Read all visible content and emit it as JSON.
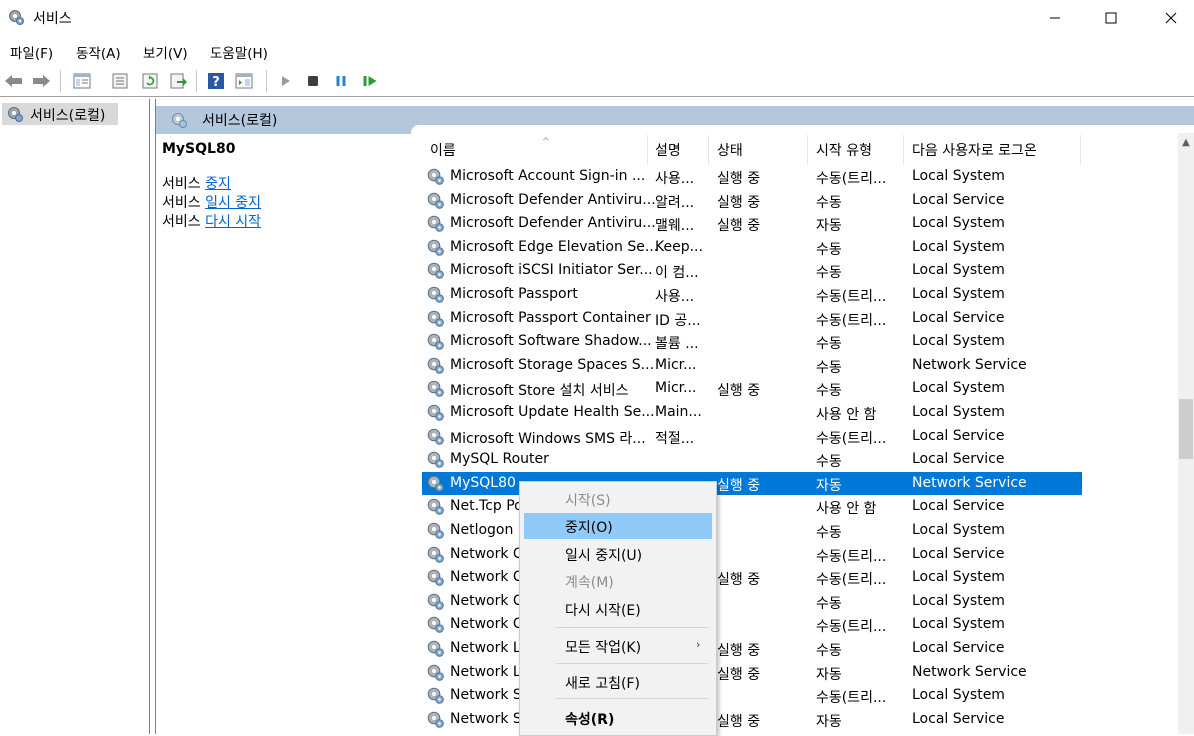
{
  "window": {
    "title": "서비스",
    "buttons": {
      "minimize": "—",
      "maximize": "☐",
      "close": "✕"
    }
  },
  "menu": [
    "파일(F)",
    "동작(A)",
    "보기(V)",
    "도움말(H)"
  ],
  "tree": {
    "selected": "서비스(로컬)"
  },
  "pane": {
    "header": "서비스(로컬)",
    "selected_service": "MySQL80",
    "actions": [
      {
        "prefix": "서비스 ",
        "link": "중지"
      },
      {
        "prefix": "서비스 ",
        "link": "일시 중지"
      },
      {
        "prefix": "서비스 ",
        "link": "다시 시작"
      }
    ]
  },
  "columns": {
    "name": "이름",
    "desc": "설명",
    "state": "상태",
    "start_type": "시작 유형",
    "logon": "다음 사용자로 로그온"
  },
  "rows": [
    {
      "name": "Microsoft Account Sign-in ...",
      "desc": "사용...",
      "state": "실행 중",
      "start": "수동(트리...",
      "logon": "Local System"
    },
    {
      "name": "Microsoft Defender Antiviru...",
      "desc": "알려...",
      "state": "실행 중",
      "start": "수동",
      "logon": "Local Service"
    },
    {
      "name": "Microsoft Defender Antiviru...",
      "desc": "맬웨...",
      "state": "실행 중",
      "start": "자동",
      "logon": "Local System"
    },
    {
      "name": "Microsoft Edge Elevation Se...",
      "desc": "Keep...",
      "state": "",
      "start": "수동",
      "logon": "Local System"
    },
    {
      "name": "Microsoft iSCSI Initiator Ser...",
      "desc": "이 컴...",
      "state": "",
      "start": "수동",
      "logon": "Local System"
    },
    {
      "name": "Microsoft Passport",
      "desc": "사용...",
      "state": "",
      "start": "수동(트리...",
      "logon": "Local System"
    },
    {
      "name": "Microsoft Passport Container",
      "desc": "ID 공...",
      "state": "",
      "start": "수동(트리...",
      "logon": "Local Service"
    },
    {
      "name": "Microsoft Software Shadow...",
      "desc": "볼륨 ...",
      "state": "",
      "start": "수동",
      "logon": "Local System"
    },
    {
      "name": "Microsoft Storage Spaces S...",
      "desc": "Micr...",
      "state": "",
      "start": "수동",
      "logon": "Network Service"
    },
    {
      "name": "Microsoft Store 설치 서비스",
      "desc": "Micr...",
      "state": "실행 중",
      "start": "수동",
      "logon": "Local System"
    },
    {
      "name": "Microsoft Update Health Se...",
      "desc": "Main...",
      "state": "",
      "start": "사용 안 함",
      "logon": "Local System"
    },
    {
      "name": "Microsoft Windows SMS 라...",
      "desc": "적절...",
      "state": "",
      "start": "수동(트리...",
      "logon": "Local Service"
    },
    {
      "name": "MySQL Router",
      "desc": "",
      "state": "",
      "start": "수동",
      "logon": "Local Service"
    },
    {
      "name": "MySQL80",
      "desc": "",
      "state": "실행 중",
      "start": "자동",
      "logon": "Network Service",
      "selected": true
    },
    {
      "name": "Net.Tcp Po",
      "desc": "",
      "state": "",
      "start": "사용 안 함",
      "logon": "Local Service"
    },
    {
      "name": "Netlogon",
      "desc": "",
      "state": "",
      "start": "수동",
      "logon": "Local System"
    },
    {
      "name": "Network C",
      "desc": "",
      "state": "",
      "start": "수동(트리...",
      "logon": "Local Service"
    },
    {
      "name": "Network C",
      "desc": "",
      "state": "실행 중",
      "start": "수동(트리...",
      "logon": "Local System"
    },
    {
      "name": "Network C",
      "desc": "",
      "state": "",
      "start": "수동",
      "logon": "Local System"
    },
    {
      "name": "Network C",
      "desc": "",
      "state": "",
      "start": "수동(트리...",
      "logon": "Local System"
    },
    {
      "name": "Network Li",
      "desc": "",
      "state": "실행 중",
      "start": "수동",
      "logon": "Local Service"
    },
    {
      "name": "Network Lo",
      "desc": "",
      "state": "실행 중",
      "start": "자동",
      "logon": "Network Service"
    },
    {
      "name": "Network Se",
      "desc": "",
      "state": "",
      "start": "수동(트리...",
      "logon": "Local System"
    },
    {
      "name": "Network St",
      "desc": "",
      "state": "실행 중",
      "start": "자동",
      "logon": "Local Service"
    }
  ],
  "context_menu": [
    {
      "label": "시작(S)",
      "disabled": true
    },
    {
      "label": "중지(O)",
      "hover": true
    },
    {
      "label": "일시 중지(U)"
    },
    {
      "label": "계속(M)",
      "disabled": true
    },
    {
      "label": "다시 시작(E)"
    },
    {
      "label": "모든 작업(K)",
      "submenu": true
    },
    {
      "label": "새로 고침(F)"
    },
    {
      "label": "속성(R)",
      "bold": true
    }
  ],
  "context_submenu_arrow": "›",
  "sort_indicator": "^"
}
